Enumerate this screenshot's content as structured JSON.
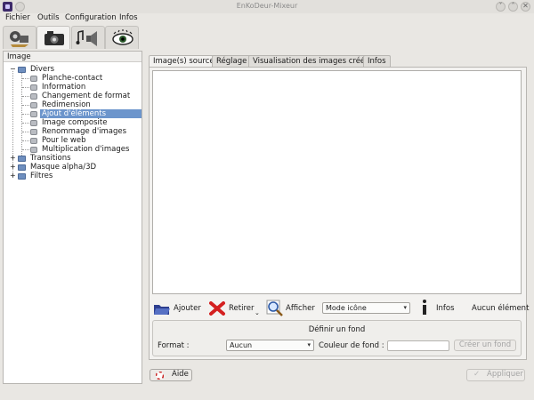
{
  "window": {
    "title": "EnKoDeur-Mixeur",
    "minimize_glyph": "˅",
    "maximize_glyph": "˄",
    "close_glyph": "✕"
  },
  "menubar": {
    "items": [
      "Fichier",
      "Outils",
      "Configuration",
      "Infos"
    ]
  },
  "toolbar": {
    "tabs": [
      "video-camera-icon",
      "photo-camera-icon",
      "music-speaker-icon",
      "eye-icon"
    ]
  },
  "left_panel": {
    "header": "Image",
    "tree": [
      {
        "label": "Divers",
        "level": 0,
        "expanded": true,
        "expander": "−"
      },
      {
        "label": "Planche-contact",
        "level": 1
      },
      {
        "label": "Information",
        "level": 1
      },
      {
        "label": "Changement de format",
        "level": 1
      },
      {
        "label": "Redimension",
        "level": 1
      },
      {
        "label": "Ajout d'éléments",
        "level": 1,
        "selected": true
      },
      {
        "label": "Image composite",
        "level": 1
      },
      {
        "label": "Renommage d'images",
        "level": 1
      },
      {
        "label": "Pour le web",
        "level": 1
      },
      {
        "label": "Multiplication d'images",
        "level": 1
      },
      {
        "label": "Transitions",
        "level": 0,
        "expander": "+"
      },
      {
        "label": "Masque alpha/3D",
        "level": 0,
        "expander": "+"
      },
      {
        "label": "Filtres",
        "level": 0,
        "expander": "+"
      }
    ]
  },
  "tabs": [
    "Image(s) source",
    "Réglage",
    "Visualisation des images créées",
    "Infos"
  ],
  "actions": {
    "add": "Ajouter",
    "remove": "Retirer",
    "show": "Afficher",
    "mode": "Mode icône",
    "infos": "Infos",
    "selection_status": "Aucun élément"
  },
  "fond": {
    "title": "Définir un fond",
    "format_label": "Format :",
    "format_value": "Aucun",
    "color_label": "Couleur de fond :",
    "color_value": "",
    "create_button": "Créer un fond"
  },
  "footer": {
    "help": "Aide",
    "apply": "Appliquer"
  },
  "colors": {
    "selection": "#6c95cc",
    "window_bg": "#e9e7e3"
  }
}
